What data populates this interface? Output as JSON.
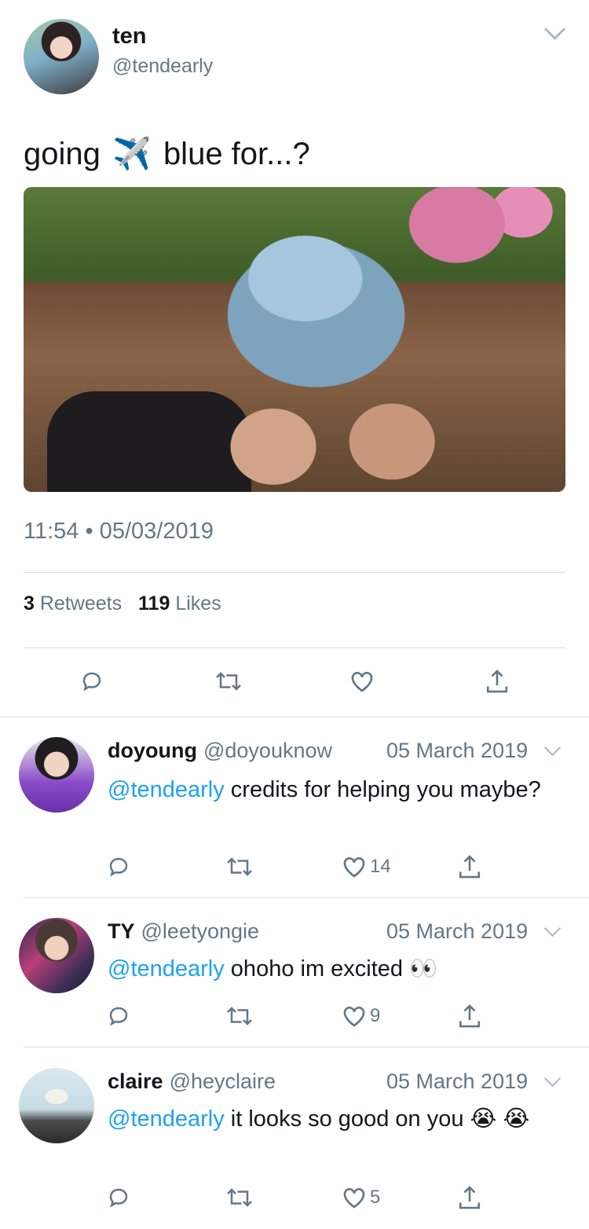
{
  "tweet": {
    "author_name": "ten",
    "author_handle": "@tendearly",
    "text_before": "going",
    "emoji": "✈️",
    "text_after": "blue for...?",
    "timestamp": "11:54 • 05/03/2019",
    "retweets_count": "3",
    "retweets_label": "Retweets",
    "likes_count": "119",
    "likes_label": "Likes"
  },
  "actions": {
    "reply_icon": "reply-icon",
    "retweet_icon": "retweet-icon",
    "like_icon": "heart-icon",
    "share_icon": "share-icon"
  },
  "replies": [
    {
      "name": "doyoung",
      "handle": "@doyouknow",
      "date": "05 March 2019",
      "mention": "@tendearly",
      "text": " credits for helping you maybe?",
      "emoji": "",
      "likes": "14"
    },
    {
      "name": "TY",
      "handle": "@leetyongie",
      "date": "05 March 2019",
      "mention": "@tendearly",
      "text": " ohoho im excited ",
      "emoji": "👀",
      "likes": "9"
    },
    {
      "name": "claire",
      "handle": "@heyclaire",
      "date": "05 March 2019",
      "mention": "@tendearly",
      "text": " it looks so good on you ",
      "emoji": "😭 😭",
      "likes": "5"
    }
  ],
  "colors": {
    "mention": "#1da1f2",
    "secondary_text": "#657786",
    "divider": "#d8dde2"
  }
}
